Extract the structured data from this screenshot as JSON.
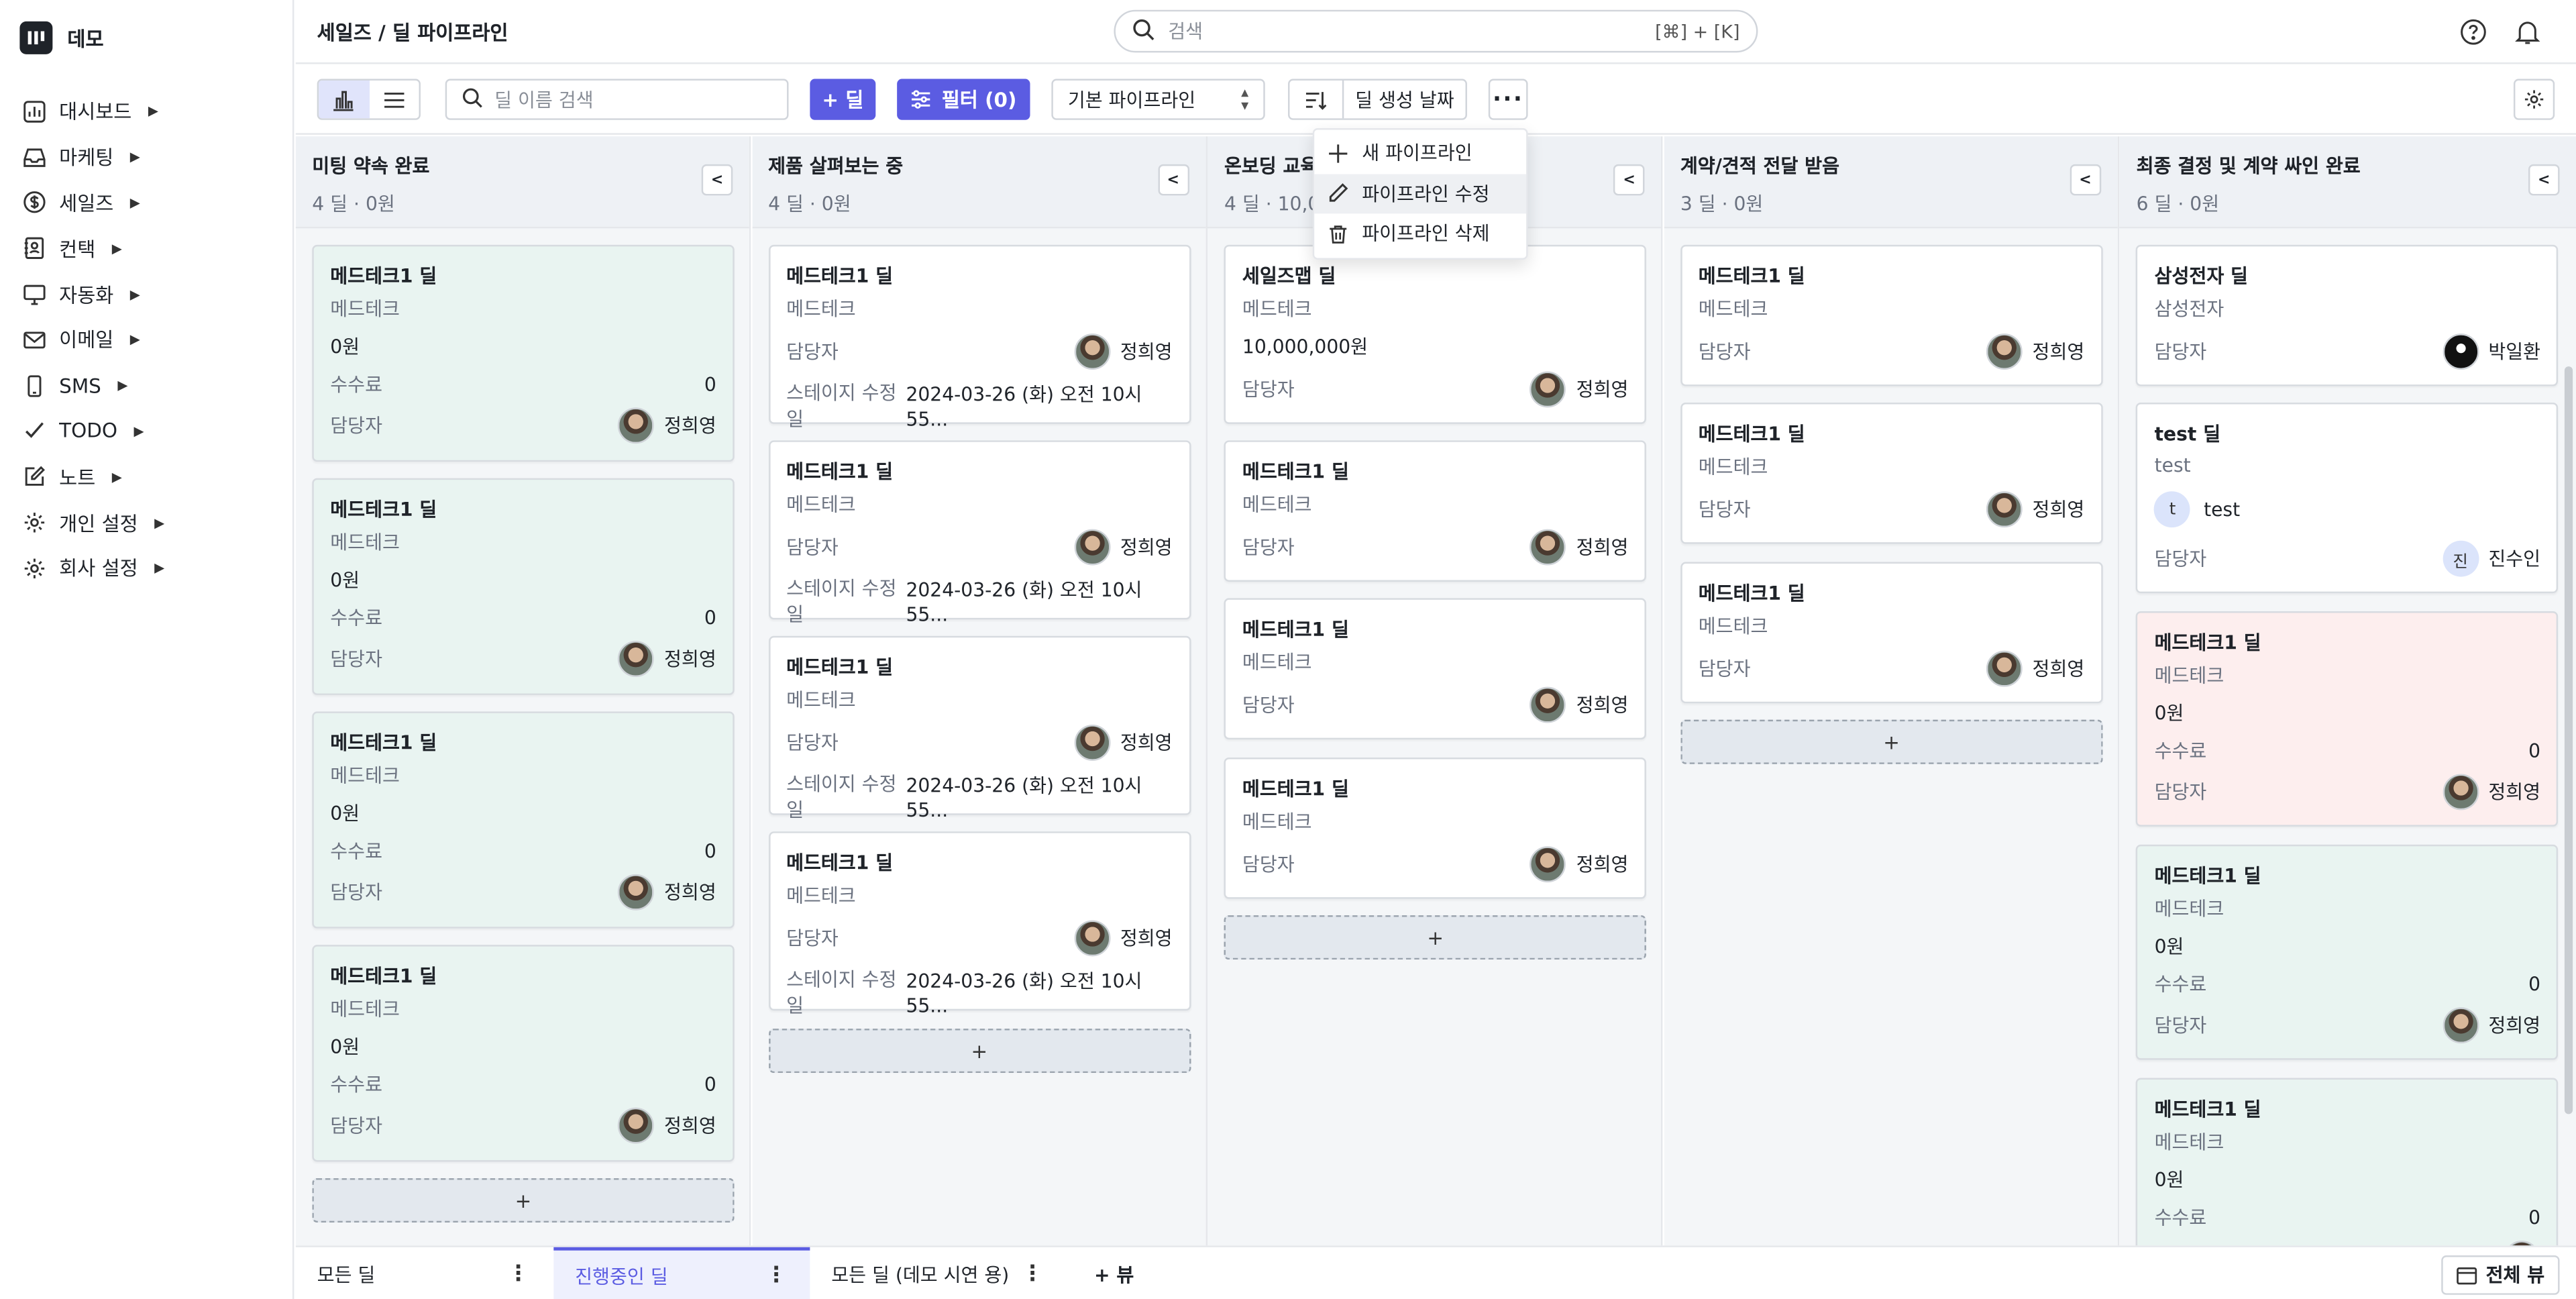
{
  "app": {
    "name": "데모"
  },
  "sidebar": {
    "items": [
      {
        "label": "대시보드",
        "icon": "chart-icon"
      },
      {
        "label": "마케팅",
        "icon": "inbox-icon"
      },
      {
        "label": "세일즈",
        "icon": "dollar-icon"
      },
      {
        "label": "컨택",
        "icon": "contacts-icon"
      },
      {
        "label": "자동화",
        "icon": "monitor-icon"
      },
      {
        "label": "이메일",
        "icon": "mail-icon"
      },
      {
        "label": "SMS",
        "icon": "phone-icon"
      },
      {
        "label": "TODO",
        "icon": "check-icon"
      },
      {
        "label": "노트",
        "icon": "edit-icon"
      },
      {
        "label": "개인 설정",
        "icon": "gear-icon"
      },
      {
        "label": "회사 설정",
        "icon": "gear-icon"
      }
    ]
  },
  "header": {
    "breadcrumb": "세일즈 / 딜 파이프라인",
    "search_placeholder": "검색",
    "search_shortcut": "[⌘] + [K]"
  },
  "toolbar": {
    "deal_search_placeholder": "딜 이름 검색",
    "add_label": "+ 딜",
    "filter_label": "필터 (0)",
    "pipeline_select": "기본 파이프라인",
    "sort_label": "딜 생성 날짜",
    "more_label": "···"
  },
  "menu": {
    "items": [
      {
        "label": "새 파이프라인",
        "icon": "plus-icon"
      },
      {
        "label": "파이프라인 수정",
        "icon": "pencil-icon"
      },
      {
        "label": "파이프라인 삭제",
        "icon": "trash-icon"
      }
    ]
  },
  "labels": {
    "owner": "담당자",
    "fee": "수수료",
    "stage_modified": "스테이지 수정일",
    "add": "+"
  },
  "columns": [
    {
      "title": "미팅 약속 완료",
      "summary": "4 딜  ·  0원",
      "cards": [
        {
          "title": "메드테크1 딜",
          "company": "메드테크",
          "amount": "0원",
          "fee": "0",
          "owner": "정희영"
        },
        {
          "title": "메드테크1 딜",
          "company": "메드테크",
          "amount": "0원",
          "fee": "0",
          "owner": "정희영"
        },
        {
          "title": "메드테크1 딜",
          "company": "메드테크",
          "amount": "0원",
          "fee": "0",
          "owner": "정희영"
        },
        {
          "title": "메드테크1 딜",
          "company": "메드테크",
          "amount": "0원",
          "fee": "0",
          "owner": "정희영"
        }
      ]
    },
    {
      "title": "제품 살펴보는 중",
      "summary": "4 딜  ·  0원",
      "cards": [
        {
          "title": "메드테크1 딜",
          "company": "메드테크",
          "owner": "정희영",
          "stage_date": "2024-03-26 (화) 오전 10시 55..."
        },
        {
          "title": "메드테크1 딜",
          "company": "메드테크",
          "owner": "정희영",
          "stage_date": "2024-03-26 (화) 오전 10시 55..."
        },
        {
          "title": "메드테크1 딜",
          "company": "메드테크",
          "owner": "정희영",
          "stage_date": "2024-03-26 (화) 오전 10시 55..."
        },
        {
          "title": "메드테크1 딜",
          "company": "메드테크",
          "owner": "정희영",
          "stage_date": "2024-03-26 (화) 오전 10시 55..."
        }
      ]
    },
    {
      "title": "온보딩 교육",
      "summary": "4 딜  ·  10,0",
      "cards": [
        {
          "title": "세일즈맵 딜",
          "company": "메드테크",
          "amount": "10,000,000원",
          "owner": "정희영"
        },
        {
          "title": "메드테크1 딜",
          "company": "메드테크",
          "owner": "정희영"
        },
        {
          "title": "메드테크1 딜",
          "company": "메드테크",
          "owner": "정희영"
        },
        {
          "title": "메드테크1 딜",
          "company": "메드테크",
          "owner": "정희영"
        }
      ]
    },
    {
      "title": "계약/견적 전달 받음",
      "summary": "3 딜  ·  0원",
      "cards": [
        {
          "title": "메드테크1 딜",
          "company": "메드테크",
          "owner": "정희영"
        },
        {
          "title": "메드테크1 딜",
          "company": "메드테크",
          "owner": "정희영"
        },
        {
          "title": "메드테크1 딜",
          "company": "메드테크",
          "owner": "정희영"
        }
      ]
    },
    {
      "title": "최종 결정 및 계약 싸인 완료",
      "summary": "6 딜  ·  0원",
      "cards": [
        {
          "title": "삼성전자 딜",
          "company": "삼성전자",
          "owner": "박일환"
        },
        {
          "title": "test 딜",
          "company": "test",
          "contact_initial": "t",
          "contact": "test",
          "owner_initial": "진",
          "owner": "진수인"
        },
        {
          "title": "메드테크1 딜",
          "company": "메드테크",
          "amount": "0원",
          "fee": "0",
          "owner": "정희영"
        },
        {
          "title": "메드테크1 딜",
          "company": "메드테크",
          "amount": "0원",
          "fee": "0",
          "owner": "정희영"
        },
        {
          "title": "메드테크1 딜",
          "company": "메드테크",
          "amount": "0원",
          "fee": "0"
        }
      ]
    }
  ],
  "bottom_tabs": [
    {
      "label": "모든 딜"
    },
    {
      "label": "진행중인 딜"
    },
    {
      "label": "모든 딜 (데모 시연 용)"
    },
    {
      "label": "+ 뷰"
    }
  ],
  "full_view_label": "전체 뷰",
  "colors": {
    "accent": "#5b5ce2",
    "card_green": "#e9f4f1",
    "card_pink": "#fdeeee"
  }
}
